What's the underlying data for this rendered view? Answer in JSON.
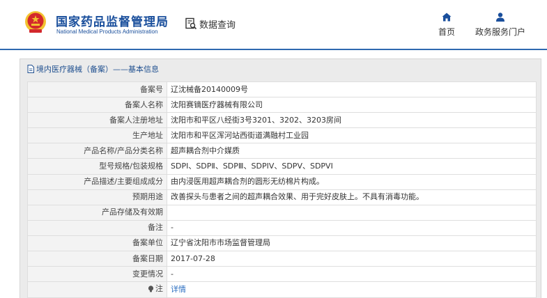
{
  "header": {
    "brand_cn": "国家药品监督管理局",
    "brand_en": "National Medical Products Administration",
    "query_label": "数据查询",
    "nav": [
      {
        "label": "首页",
        "icon": "home-icon"
      },
      {
        "label": "政务服务门户",
        "icon": "user-icon"
      }
    ]
  },
  "panel": {
    "title": "境内医疗器械（备案）——基本信息",
    "title_icon": "document-icon"
  },
  "rows": [
    {
      "label": "备案号",
      "value": "辽沈械备20140009号"
    },
    {
      "label": "备案人名称",
      "value": "沈阳赛镝医疗器械有限公司"
    },
    {
      "label": "备案人注册地址",
      "value": "沈阳市和平区八经街3号3201、3202、3203房间"
    },
    {
      "label": "生产地址",
      "value": "沈阳市和平区浑河站西街道满融村工业园"
    },
    {
      "label": "产品名称/产品分类名称",
      "value": "超声耦合剂中介媒质"
    },
    {
      "label": "型号规格/包装规格",
      "value": "SDPⅠ、SDPⅡ、SDPⅢ、SDPIV、SDPⅤ、SDPVI"
    },
    {
      "label": "产品描述/主要组成成分",
      "value": "由内浸医用超声耦合剂的圆形无纺棉片构成。"
    },
    {
      "label": "预期用途",
      "value": "改善探头与患者之间的超声耦合效果、用于完好皮肤上。不具有消毒功能。"
    },
    {
      "label": "产品存储及有效期",
      "value": ""
    },
    {
      "label": "备注",
      "value": "-"
    },
    {
      "label": "备案单位",
      "value": "辽宁省沈阳市市场监督管理局"
    },
    {
      "label": "备案日期",
      "value": "2017-07-28"
    },
    {
      "label": "变更情况",
      "value": "-"
    },
    {
      "label": "注",
      "value": "详情",
      "icon": "info-bulb-icon"
    }
  ],
  "colors": {
    "brand_blue": "#1a4f9c",
    "accent_blue": "#2e69b0",
    "link_blue": "#2c6fc1",
    "emblem_red": "#d3292c",
    "emblem_gold": "#f2c230"
  }
}
